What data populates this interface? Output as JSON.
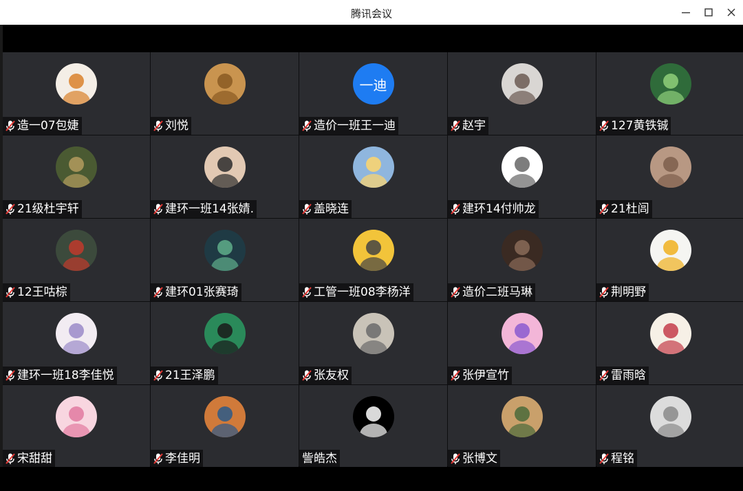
{
  "window": {
    "title": "腾讯会议",
    "minimize_icon": "minimize-icon",
    "maximize_icon": "maximize-icon",
    "close_icon": "close-icon"
  },
  "participants": [
    {
      "name": "造一07包婕",
      "muted": true,
      "avatar": {
        "bg": "#f4eee6",
        "fg": "#d9812b"
      }
    },
    {
      "name": "刘悦",
      "muted": true,
      "avatar": {
        "bg": "#c9944f",
        "fg": "#8a5a22"
      }
    },
    {
      "name": "造价一班王一迪",
      "muted": true,
      "avatar": {
        "bg": "#1e7cf2",
        "text": "一迪"
      }
    },
    {
      "name": "赵宇",
      "muted": true,
      "avatar": {
        "bg": "#d9d6d3",
        "fg": "#6b5a52"
      }
    },
    {
      "name": "127黄铁铖",
      "muted": true,
      "avatar": {
        "bg": "#2f6b3a",
        "fg": "#8fcf7a"
      }
    },
    {
      "name": "21级杜宇轩",
      "muted": true,
      "avatar": {
        "bg": "#4a5a32",
        "fg": "#b39b5e"
      }
    },
    {
      "name": "建环一班14张婧.",
      "muted": true,
      "avatar": {
        "bg": "#e2c9b3",
        "fg": "#2d2d2d"
      }
    },
    {
      "name": "盖晓连",
      "muted": true,
      "avatar": {
        "bg": "#8fb6de",
        "fg": "#ffd66b"
      }
    },
    {
      "name": "建环14付帅龙",
      "muted": true,
      "avatar": {
        "bg": "#ffffff",
        "fg": "#666666"
      }
    },
    {
      "name": "21杜闾",
      "muted": true,
      "avatar": {
        "bg": "#b89883",
        "fg": "#7d5e4c"
      }
    },
    {
      "name": "12王咕棕",
      "muted": true,
      "avatar": {
        "bg": "#3c4a3c",
        "fg": "#c0392b"
      }
    },
    {
      "name": "建环01张赛琦",
      "muted": true,
      "avatar": {
        "bg": "#1f3a44",
        "fg": "#5fae8a"
      }
    },
    {
      "name": "工管一班08李杨洋",
      "muted": true,
      "avatar": {
        "bg": "#f2c43a",
        "fg": "#444444"
      }
    },
    {
      "name": "造价二班马琳",
      "muted": true,
      "avatar": {
        "bg": "#3a2a22",
        "fg": "#8a6b58"
      }
    },
    {
      "name": "荆明野",
      "muted": true,
      "avatar": {
        "bg": "#f5f5f2",
        "fg": "#f0b020"
      }
    },
    {
      "name": "建环一班18李佳悦",
      "muted": true,
      "avatar": {
        "bg": "#f2ecf2",
        "fg": "#9b8bc9"
      }
    },
    {
      "name": "21王泽鹏",
      "muted": true,
      "avatar": {
        "bg": "#2a8a5a",
        "fg": "#1a1a1a"
      }
    },
    {
      "name": "张友权",
      "muted": true,
      "avatar": {
        "bg": "#c9c3b8",
        "fg": "#6b6b6b"
      }
    },
    {
      "name": "张伊宣竹",
      "muted": true,
      "avatar": {
        "bg": "#f3b6d8",
        "fg": "#8a5ad0"
      }
    },
    {
      "name": "雷雨晗",
      "muted": true,
      "avatar": {
        "bg": "#f6f0e6",
        "fg": "#c43d4a"
      }
    },
    {
      "name": "宋甜甜",
      "muted": true,
      "avatar": {
        "bg": "#f8d6e0",
        "fg": "#e27aa0"
      }
    },
    {
      "name": "李佳明",
      "muted": true,
      "avatar": {
        "bg": "#d07a3a",
        "fg": "#2c5a8a"
      }
    },
    {
      "name": "訾皓杰",
      "muted": false,
      "avatar": {
        "bg": "#000000",
        "fg": "#ffffff"
      }
    },
    {
      "name": "张博文",
      "muted": true,
      "avatar": {
        "bg": "#c9a06b",
        "fg": "#4a6a3a"
      }
    },
    {
      "name": "程铭",
      "muted": true,
      "avatar": {
        "bg": "#dcdcdc",
        "fg": "#8a8a8a"
      }
    }
  ],
  "colors": {
    "tile_bg": "#2b2c30",
    "mute_red": "#e53935",
    "tag_bg": "rgba(0,0,0,0.55)"
  },
  "icons": {
    "mic_muted": "mic-muted-icon"
  }
}
